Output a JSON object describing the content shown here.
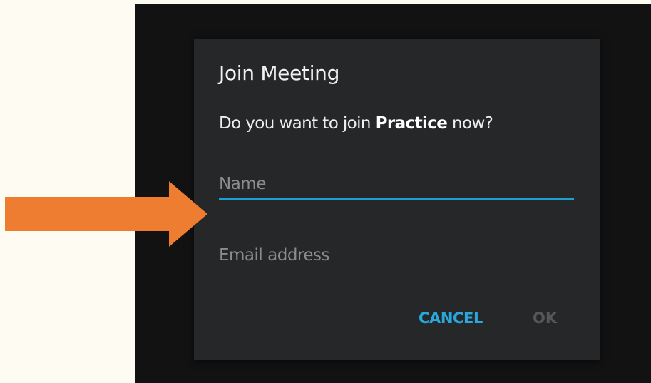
{
  "dialog": {
    "title": "Join Meeting",
    "message_prefix": "Do you want to join ",
    "meeting_name": "Practice",
    "message_suffix": " now?",
    "name_placeholder": "Name",
    "email_placeholder": "Email address",
    "cancel_label": "CANCEL",
    "ok_label": "OK"
  },
  "annotation": {
    "arrow_icon": "right-arrow-icon",
    "arrow_color": "#ee7d31"
  },
  "colors": {
    "accent": "#28a8dc",
    "dialog_background": "#252729",
    "screen_background": "#121212",
    "page_background": "#fefbf2",
    "disabled_text": "#55585b"
  }
}
